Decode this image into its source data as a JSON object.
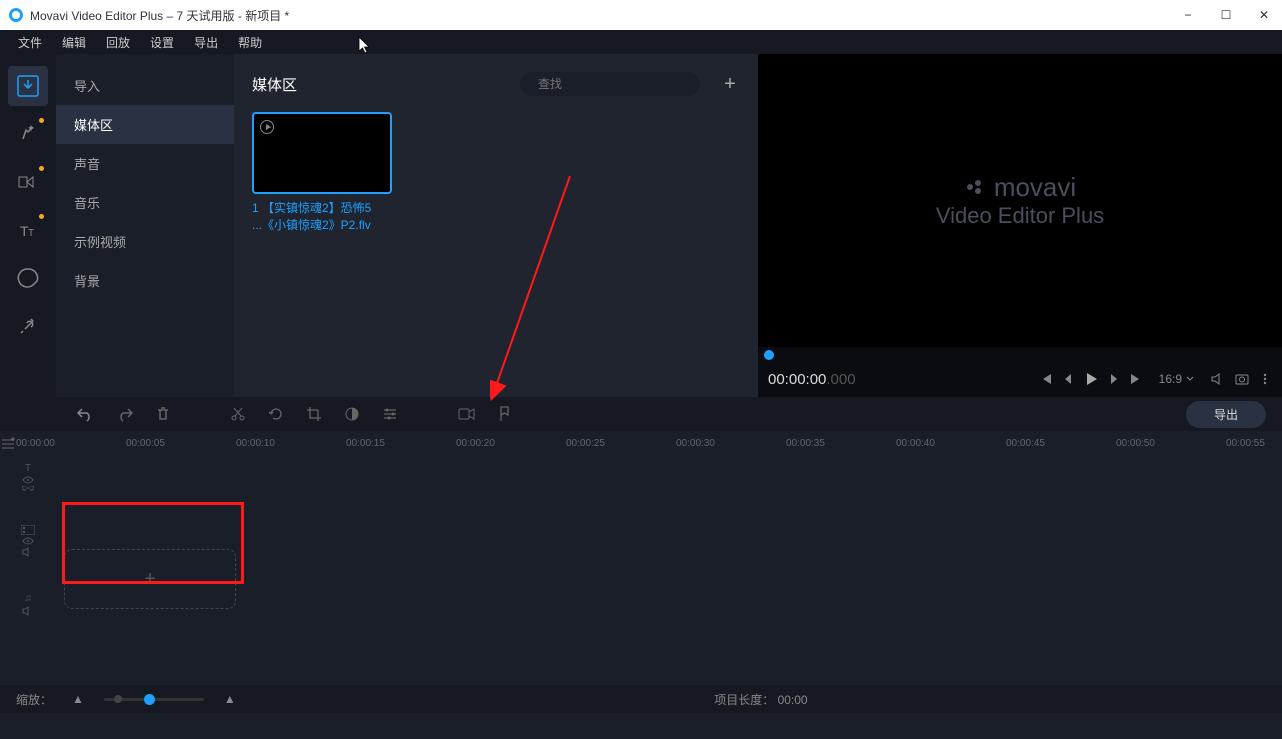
{
  "window": {
    "title": "Movavi Video Editor Plus – 7 天试用版 - 新项目 *"
  },
  "menubar": {
    "items": [
      "文件",
      "编辑",
      "回放",
      "设置",
      "导出",
      "帮助"
    ]
  },
  "vtoolbar": {
    "icons": [
      "import",
      "fx",
      "transitions",
      "titles",
      "stickers",
      "tools"
    ]
  },
  "sidebar": {
    "items": [
      "导入",
      "媒体区",
      "声音",
      "音乐",
      "示例视频",
      "背景"
    ],
    "active_index": 1
  },
  "media": {
    "title": "媒体区",
    "search_placeholder": "查找",
    "clip": {
      "line1": "1 【实镇惊魂2】恐怖5",
      "line2": "...《小镇惊魂2》P2.flv"
    }
  },
  "preview": {
    "brand": "movavi",
    "product": "Video Editor Plus",
    "time_main": "00:00:00",
    "time_ms": ".000",
    "aspect": "16:9"
  },
  "timeline": {
    "export_label": "导出",
    "ruler": [
      "00:00:00",
      "00:00:05",
      "00:00:10",
      "00:00:15",
      "00:00:20",
      "00:00:25",
      "00:00:30",
      "00:00:35",
      "00:00:40",
      "00:00:45",
      "00:00:50",
      "00:00:55"
    ]
  },
  "footer": {
    "zoom_label": "缩放：",
    "length_label": "项目长度：",
    "length_value": "00:00"
  }
}
